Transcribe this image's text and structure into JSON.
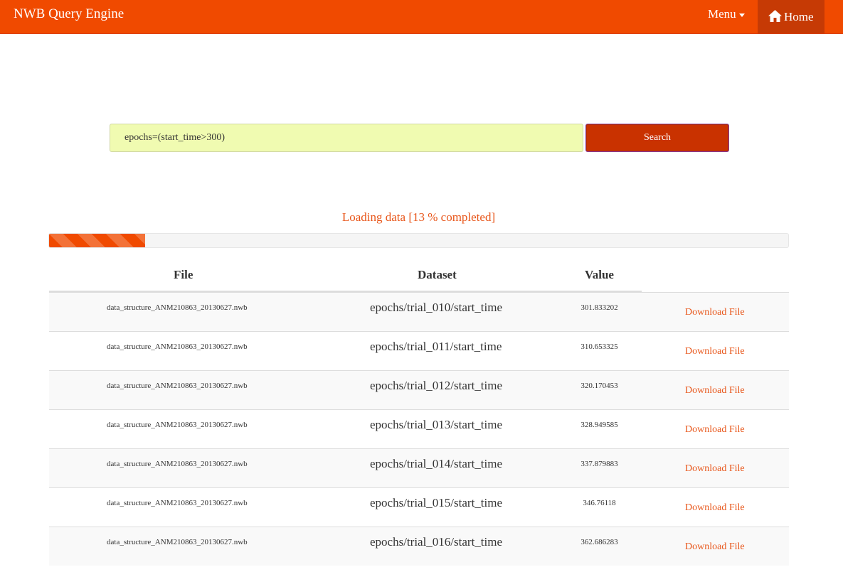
{
  "navbar": {
    "brand": "NWB Query Engine",
    "menu_label": "Menu",
    "home_label": "Home",
    "color": "#f04a00",
    "home_bg": "#c63a05"
  },
  "search": {
    "value": "epochs=(start_time>300)",
    "button_label": "Search"
  },
  "progress": {
    "text": "Loading data [13 % completed]",
    "percent": 13
  },
  "table": {
    "headers": {
      "file": "File",
      "dataset": "Dataset",
      "value": "Value"
    },
    "rows": [
      {
        "file": "data_structure_ANM210863_20130627.nwb",
        "dataset": "epochs/trial_010/start_time",
        "value": "301.833202",
        "action": "Download File"
      },
      {
        "file": "data_structure_ANM210863_20130627.nwb",
        "dataset": "epochs/trial_011/start_time",
        "value": "310.653325",
        "action": "Download File"
      },
      {
        "file": "data_structure_ANM210863_20130627.nwb",
        "dataset": "epochs/trial_012/start_time",
        "value": "320.170453",
        "action": "Download File"
      },
      {
        "file": "data_structure_ANM210863_20130627.nwb",
        "dataset": "epochs/trial_013/start_time",
        "value": "328.949585",
        "action": "Download File"
      },
      {
        "file": "data_structure_ANM210863_20130627.nwb",
        "dataset": "epochs/trial_014/start_time",
        "value": "337.879883",
        "action": "Download File"
      },
      {
        "file": "data_structure_ANM210863_20130627.nwb",
        "dataset": "epochs/trial_015/start_time",
        "value": "346.76118",
        "action": "Download File"
      },
      {
        "file": "data_structure_ANM210863_20130627.nwb",
        "dataset": "epochs/trial_016/start_time",
        "value": "362.686283",
        "action": "Download File"
      }
    ]
  },
  "icons": {
    "home": "home-icon",
    "menu_caret": "caret-down-icon"
  }
}
